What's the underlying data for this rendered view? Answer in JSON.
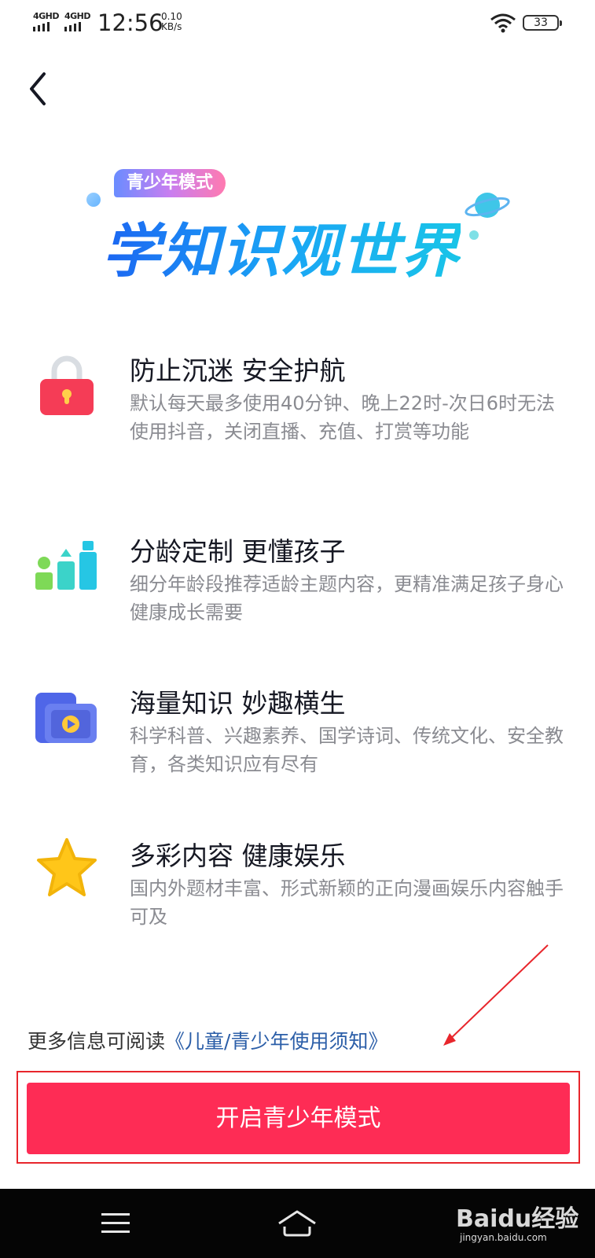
{
  "status_bar": {
    "network1": "4GHD",
    "network2": "4GHD",
    "time": "12:56",
    "speed_value": "0.10",
    "speed_unit": "KB/s",
    "battery": "33"
  },
  "banner": {
    "tag": "青少年模式",
    "headline": "学知识观世界"
  },
  "features": [
    {
      "icon": "lock-icon",
      "title": "防止沉迷 安全护航",
      "desc": "默认每天最多使用40分钟、晚上22时-次日6时无法使用抖音，关闭直播、充值、打赏等功能"
    },
    {
      "icon": "growth-chart-icon",
      "title": "分龄定制 更懂孩子",
      "desc": "细分年龄段推荐适龄主题内容，更精准满足孩子身心健康成长需要"
    },
    {
      "icon": "video-folder-icon",
      "title": "海量知识 妙趣横生",
      "desc": "科学科普、兴趣素养、国学诗词、传统文化、安全教育，各类知识应有尽有"
    },
    {
      "icon": "star-icon",
      "title": "多彩内容 健康娱乐",
      "desc": "国内外题材丰富、形式新颖的正向漫画娱乐内容触手可及"
    }
  ],
  "info": {
    "prefix": "更多信息可阅读",
    "link": "《儿童/青少年使用须知》"
  },
  "cta": {
    "label": "开启青少年模式"
  },
  "colors": {
    "primary": "#fe2c55",
    "annotation": "#e8262c",
    "link": "#2b5ea8"
  },
  "watermark": {
    "logo": "Baidu经验",
    "url": "jingyan.baidu.com"
  }
}
